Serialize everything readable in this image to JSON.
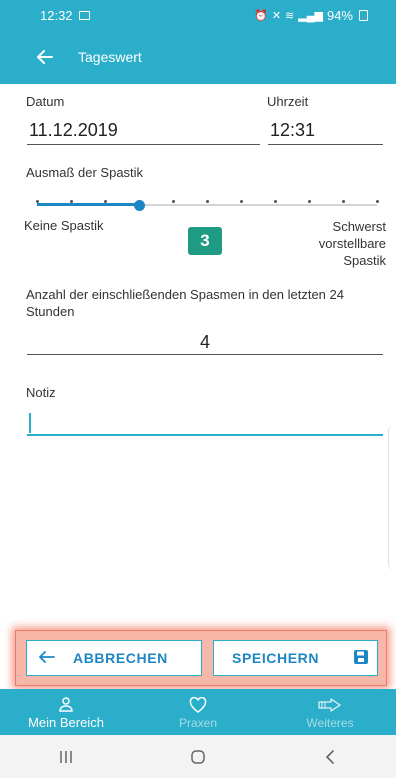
{
  "status_bar": {
    "time": "12:32",
    "battery": "94%",
    "image_icon": "image-icon",
    "signal_icons": "alarm-mute-wifi-signal-icons"
  },
  "app_bar": {
    "title": "Tageswert",
    "back_icon": "arrow-left-icon"
  },
  "form": {
    "date_label": "Datum",
    "date_value": "11.12.2019",
    "time_label": "Uhrzeit",
    "time_value": "12:31",
    "spastik_label": "Ausmaß der Spastik",
    "slider": {
      "min_label": "Keine Spastik",
      "max_label": "Schwerst vorstellbare Spastik",
      "value": "3",
      "steps": 11,
      "min": 0,
      "max": 10
    },
    "spasmen_label": "Anzahl der einschließenden Spasmen in den letzten 24 Stunden",
    "spasmen_value": "4",
    "notiz_label": "Notiz",
    "notiz_value": ""
  },
  "actions": {
    "cancel_label": "ABBRECHEN",
    "save_label": "SPEICHERN",
    "accent_color": "#1e86c4",
    "highlight_color": "#ee7b6a"
  },
  "bottom_nav": [
    {
      "label": "Mein Bereich",
      "icon": "person-icon",
      "active": true
    },
    {
      "label": "Praxen",
      "icon": "heart-icon",
      "active": false
    },
    {
      "label": "Weiteres",
      "icon": "arrow-right-outline-icon",
      "active": false
    }
  ],
  "system_nav": {
    "recents": "recents-icon",
    "home": "home-icon",
    "back": "back-chevron-icon"
  },
  "colors": {
    "primary": "#2aaec9",
    "badge": "#1f9a83"
  }
}
